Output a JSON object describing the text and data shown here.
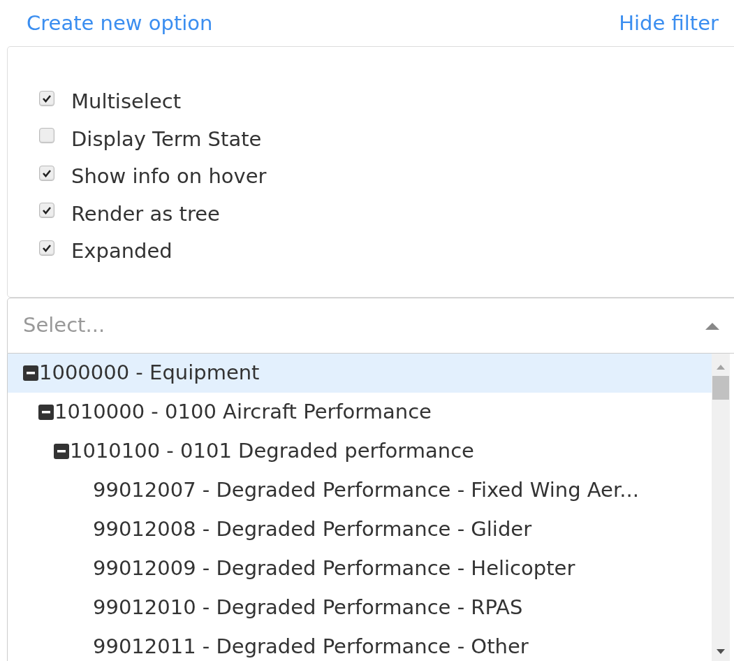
{
  "links": [
    {
      "label": "Create new option"
    },
    {
      "label": "Hide filter"
    }
  ],
  "options": [
    {
      "label": "Multiselect",
      "checked": true
    },
    {
      "label": "Display Term State",
      "checked": false
    },
    {
      "label": "Show info on hover",
      "checked": true
    },
    {
      "label": "Render as tree",
      "checked": true
    },
    {
      "label": "Expanded",
      "checked": true
    }
  ],
  "select": {
    "placeholder": "Select...",
    "open": true
  },
  "tree": [
    {
      "label": "1000000 - Equipment",
      "selected": true,
      "expanded": true,
      "children": [
        {
          "label": "1010000 - 0100 Aircraft Performance",
          "selected": false,
          "expanded": true,
          "children": [
            {
              "label": "1010100 - 0101 Degraded performance",
              "selected": false,
              "expanded": true,
              "children": [
                {
                  "label": "99012007 - Degraded Performance - Fixed Wing Aer...",
                  "selected": false
                },
                {
                  "label": "99012008 - Degraded Performance - Glider",
                  "selected": false
                },
                {
                  "label": "99012009 - Degraded Performance - Helicopter",
                  "selected": false
                },
                {
                  "label": "99012010 - Degraded Performance - RPAS",
                  "selected": false
                },
                {
                  "label": "99012011 - Degraded Performance - Other",
                  "selected": false
                }
              ]
            }
          ]
        }
      ]
    }
  ]
}
